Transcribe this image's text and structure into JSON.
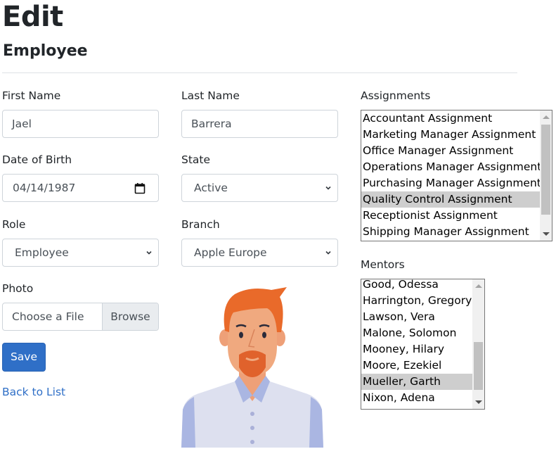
{
  "header": {
    "title": "Edit",
    "subtitle": "Employee"
  },
  "form": {
    "first_name": {
      "label": "First Name",
      "value": "Jael"
    },
    "last_name": {
      "label": "Last Name",
      "value": "Barrera"
    },
    "date_of_birth": {
      "label": "Date of Birth",
      "value": "04/14/1987"
    },
    "state": {
      "label": "State",
      "value": "Active"
    },
    "role": {
      "label": "Role",
      "value": "Employee"
    },
    "branch": {
      "label": "Branch",
      "value": "Apple Europe"
    },
    "photo": {
      "label": "Photo",
      "placeholder": "Choose a File",
      "browse_label": "Browse"
    },
    "save_label": "Save",
    "back_link": "Back to List"
  },
  "assignments": {
    "label": "Assignments",
    "options": [
      {
        "label": "Accountant Assignment",
        "selected": false
      },
      {
        "label": "Marketing Manager Assignment",
        "selected": false
      },
      {
        "label": "Office Manager Assignment",
        "selected": false
      },
      {
        "label": "Operations Manager Assignment",
        "selected": false
      },
      {
        "label": "Purchasing Manager Assignment",
        "selected": false
      },
      {
        "label": "Quality Control Assignment",
        "selected": true
      },
      {
        "label": "Receptionist Assignment",
        "selected": false
      },
      {
        "label": "Shipping Manager Assignment",
        "selected": false
      }
    ]
  },
  "mentors": {
    "label": "Mentors",
    "options": [
      {
        "label": "Good, Odessa",
        "selected": false
      },
      {
        "label": "Harrington, Gregory",
        "selected": false
      },
      {
        "label": "Lawson, Vera",
        "selected": false
      },
      {
        "label": "Malone, Solomon",
        "selected": false
      },
      {
        "label": "Mooney, Hilary",
        "selected": false
      },
      {
        "label": "Moore, Ezekiel",
        "selected": false
      },
      {
        "label": "Mueller, Garth",
        "selected": true
      },
      {
        "label": "Nixon, Adena",
        "selected": false
      }
    ]
  },
  "photo_image": {
    "alt": "employee-avatar-illustration"
  },
  "colors": {
    "primary": "#2f6fc7",
    "selected_option": "#cecece"
  }
}
